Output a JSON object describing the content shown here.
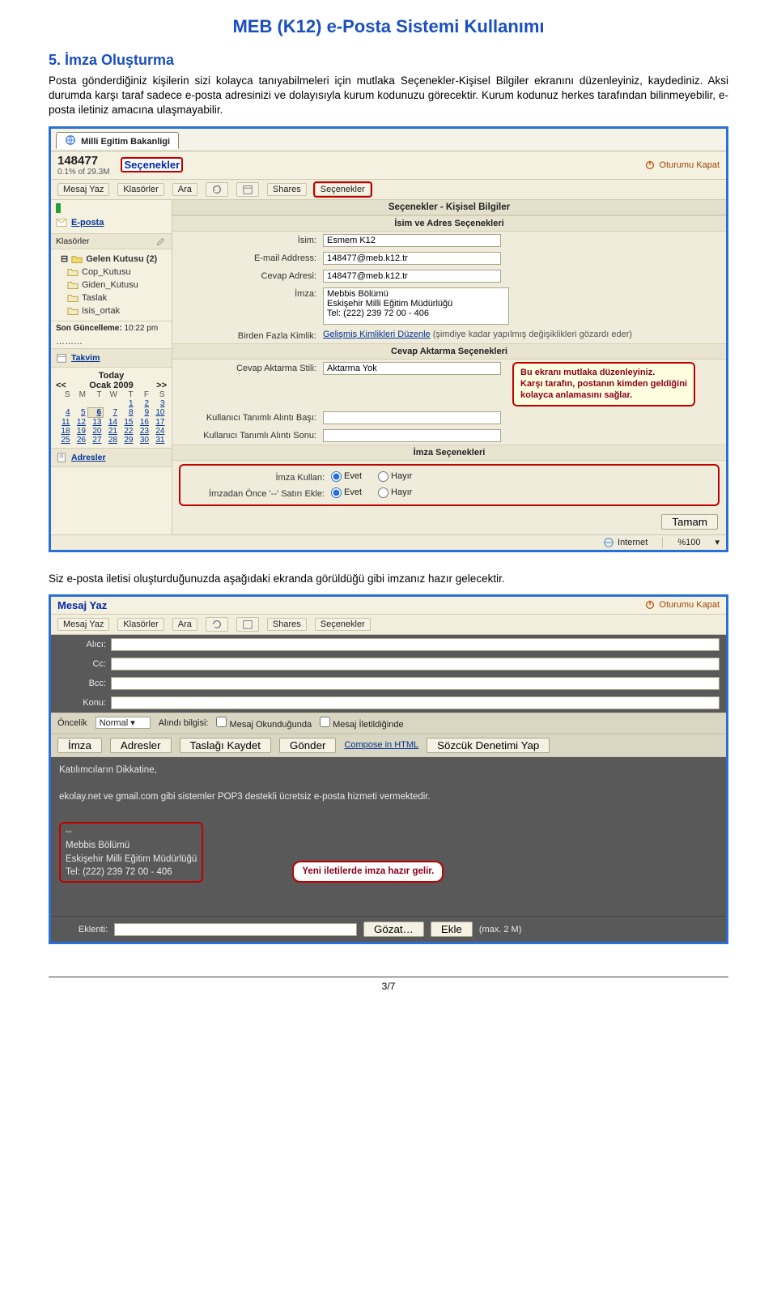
{
  "page": {
    "title": "MEB (K12) e-Posta Sistemi Kullanımı",
    "section_heading": "5. İmza Oluşturma",
    "para1": "Posta gönderdiğiniz kişilerin sizi kolayca tanıyabilmeleri için mutlaka Seçenekler-Kişisel Bilgiler ekranını düzenleyiniz, kaydediniz. Aksi durumda karşı taraf sadece e-posta adresinizi ve dolayısıyla kurum kodunuzu görecektir. Kurum kodunuz herkes tarafından bilinmeyebilir, e-posta iletiniz amacına ulaşmayabilir.",
    "para2": "Siz e-posta iletisi oluşturduğunuzda aşağıdaki ekranda görüldüğü gibi imzanız hazır gelecektir.",
    "page_number": "3/7"
  },
  "shot1": {
    "browser_tab": "Milli Egitim Bakanligi",
    "user_code": "148477",
    "quota": "0.1% of 29.3M",
    "secenekler": "Seçenekler",
    "logout": "Oturumu Kapat",
    "toolbar": [
      "Mesaj Yaz",
      "Klasörler",
      "Ara",
      "",
      "",
      "Shares",
      "Seçenekler"
    ],
    "eposta": "E-posta",
    "klasorler_hdr": "Klasörler",
    "folders": [
      "Gelen Kutusu (2)",
      "Cop_Kutusu",
      "Giden_Kutusu",
      "Taslak",
      "Isis_ortak"
    ],
    "last_update_label": "Son Güncelleme:",
    "last_update_val": "10:22 pm",
    "takvim": "Takvim",
    "cal_today": "Today",
    "cal_month": "Ocak 2009",
    "cal_days": [
      "S",
      "M",
      "T",
      "W",
      "T",
      "F",
      "S"
    ],
    "cal_rows": [
      [
        "",
        "",
        "",
        "",
        "1",
        "2",
        "3"
      ],
      [
        "4",
        "5",
        "6",
        "7",
        "8",
        "9",
        "10"
      ],
      [
        "11",
        "12",
        "13",
        "14",
        "15",
        "16",
        "17"
      ],
      [
        "18",
        "19",
        "20",
        "21",
        "22",
        "23",
        "24"
      ],
      [
        "25",
        "26",
        "27",
        "28",
        "29",
        "30",
        "31"
      ]
    ],
    "adresler": "Adresler",
    "main_hdr": "Seçenekler - Kişisel Bilgiler",
    "sec_isim": "İsim ve Adres Seçenekleri",
    "lbl_isim": "İsim:",
    "val_isim": "Esmem K12",
    "lbl_email": "E-mail Address:",
    "val_email": "148477@meb.k12.tr",
    "lbl_cevap_adr": "Cevap Adresi:",
    "val_cevap_adr": "148477@meb.k12.tr",
    "lbl_imza": "İmza:",
    "val_imza": "Mebbis Bölümü\nEskişehir Milli Eğitim Müdürlüğü\nTel: (222) 239 72 00 - 406",
    "lbl_multi": "Birden Fazla Kimlik:",
    "link_multi": "Gelişmiş Kimlikleri Düzenle",
    "hint_multi": "(şimdiye kadar yapılmış değişiklikleri gözardı eder)",
    "sec_cevap": "Cevap Aktarma Seçenekleri",
    "lbl_cevap_stil": "Cevap Aktarma Stili:",
    "val_cevap_stil": "Aktarma Yok",
    "lbl_alinti_bas": "Kullanıcı Tanımlı Alıntı Başı:",
    "lbl_alinti_son": "Kullanıcı Tanımlı Alıntı Sonu:",
    "callout1": "Bu ekranı mutlaka düzenleyiniz.\nKarşı tarafın, postanın kimden geldiğini\nkolayca anlamasını sağlar.",
    "sec_imza": "İmza Seçenekleri",
    "lbl_imza_kullan": "İmza Kullan:",
    "lbl_imza_once": "İmzadan Önce '--' Satırı Ekle:",
    "opt_evet": "Evet",
    "opt_hayir": "Hayır",
    "btn_tamam": "Tamam",
    "status_internet": "Internet",
    "status_zoom": "%100"
  },
  "shot2": {
    "title": "Mesaj Yaz",
    "logout": "Oturumu Kapat",
    "toolbar": [
      "Mesaj Yaz",
      "Klasörler",
      "Ara",
      "",
      "",
      "Shares",
      "Seçenekler"
    ],
    "lbl_alici": "Alıcı:",
    "lbl_cc": "Cc:",
    "lbl_bcc": "Bcc:",
    "lbl_konu": "Konu:",
    "lbl_oncelik": "Öncelik",
    "val_oncelik": "Normal",
    "lbl_alindi": "Alındı bilgisi:",
    "chk1": "Mesaj Okunduğunda",
    "chk2": "Mesaj İletildiğinde",
    "btns": [
      "İmza",
      "Adresler",
      "Taslağı Kaydet",
      "Gönder",
      "Compose in HTML",
      "Sözcük Denetimi Yap"
    ],
    "body_line1": "Katılımcıların Dikkatine,",
    "body_line2": "ekolay.net ve gmail.com gibi sistemler POP3 destekli ücretsiz e-posta hizmeti vermektedir.",
    "sig_lines": [
      "--",
      "Mebbis Bölümü",
      "Eskişehir Milli Eğitim Müdürlüğü",
      "Tel: (222) 239 72 00 - 406"
    ],
    "sig_callout": "Yeni iletilerde imza hazır gelir.",
    "lbl_eklenti": "Eklenti:",
    "btn_gozat": "Gözat…",
    "btn_ekle": "Ekle",
    "max_note": "(max. 2 M)"
  }
}
